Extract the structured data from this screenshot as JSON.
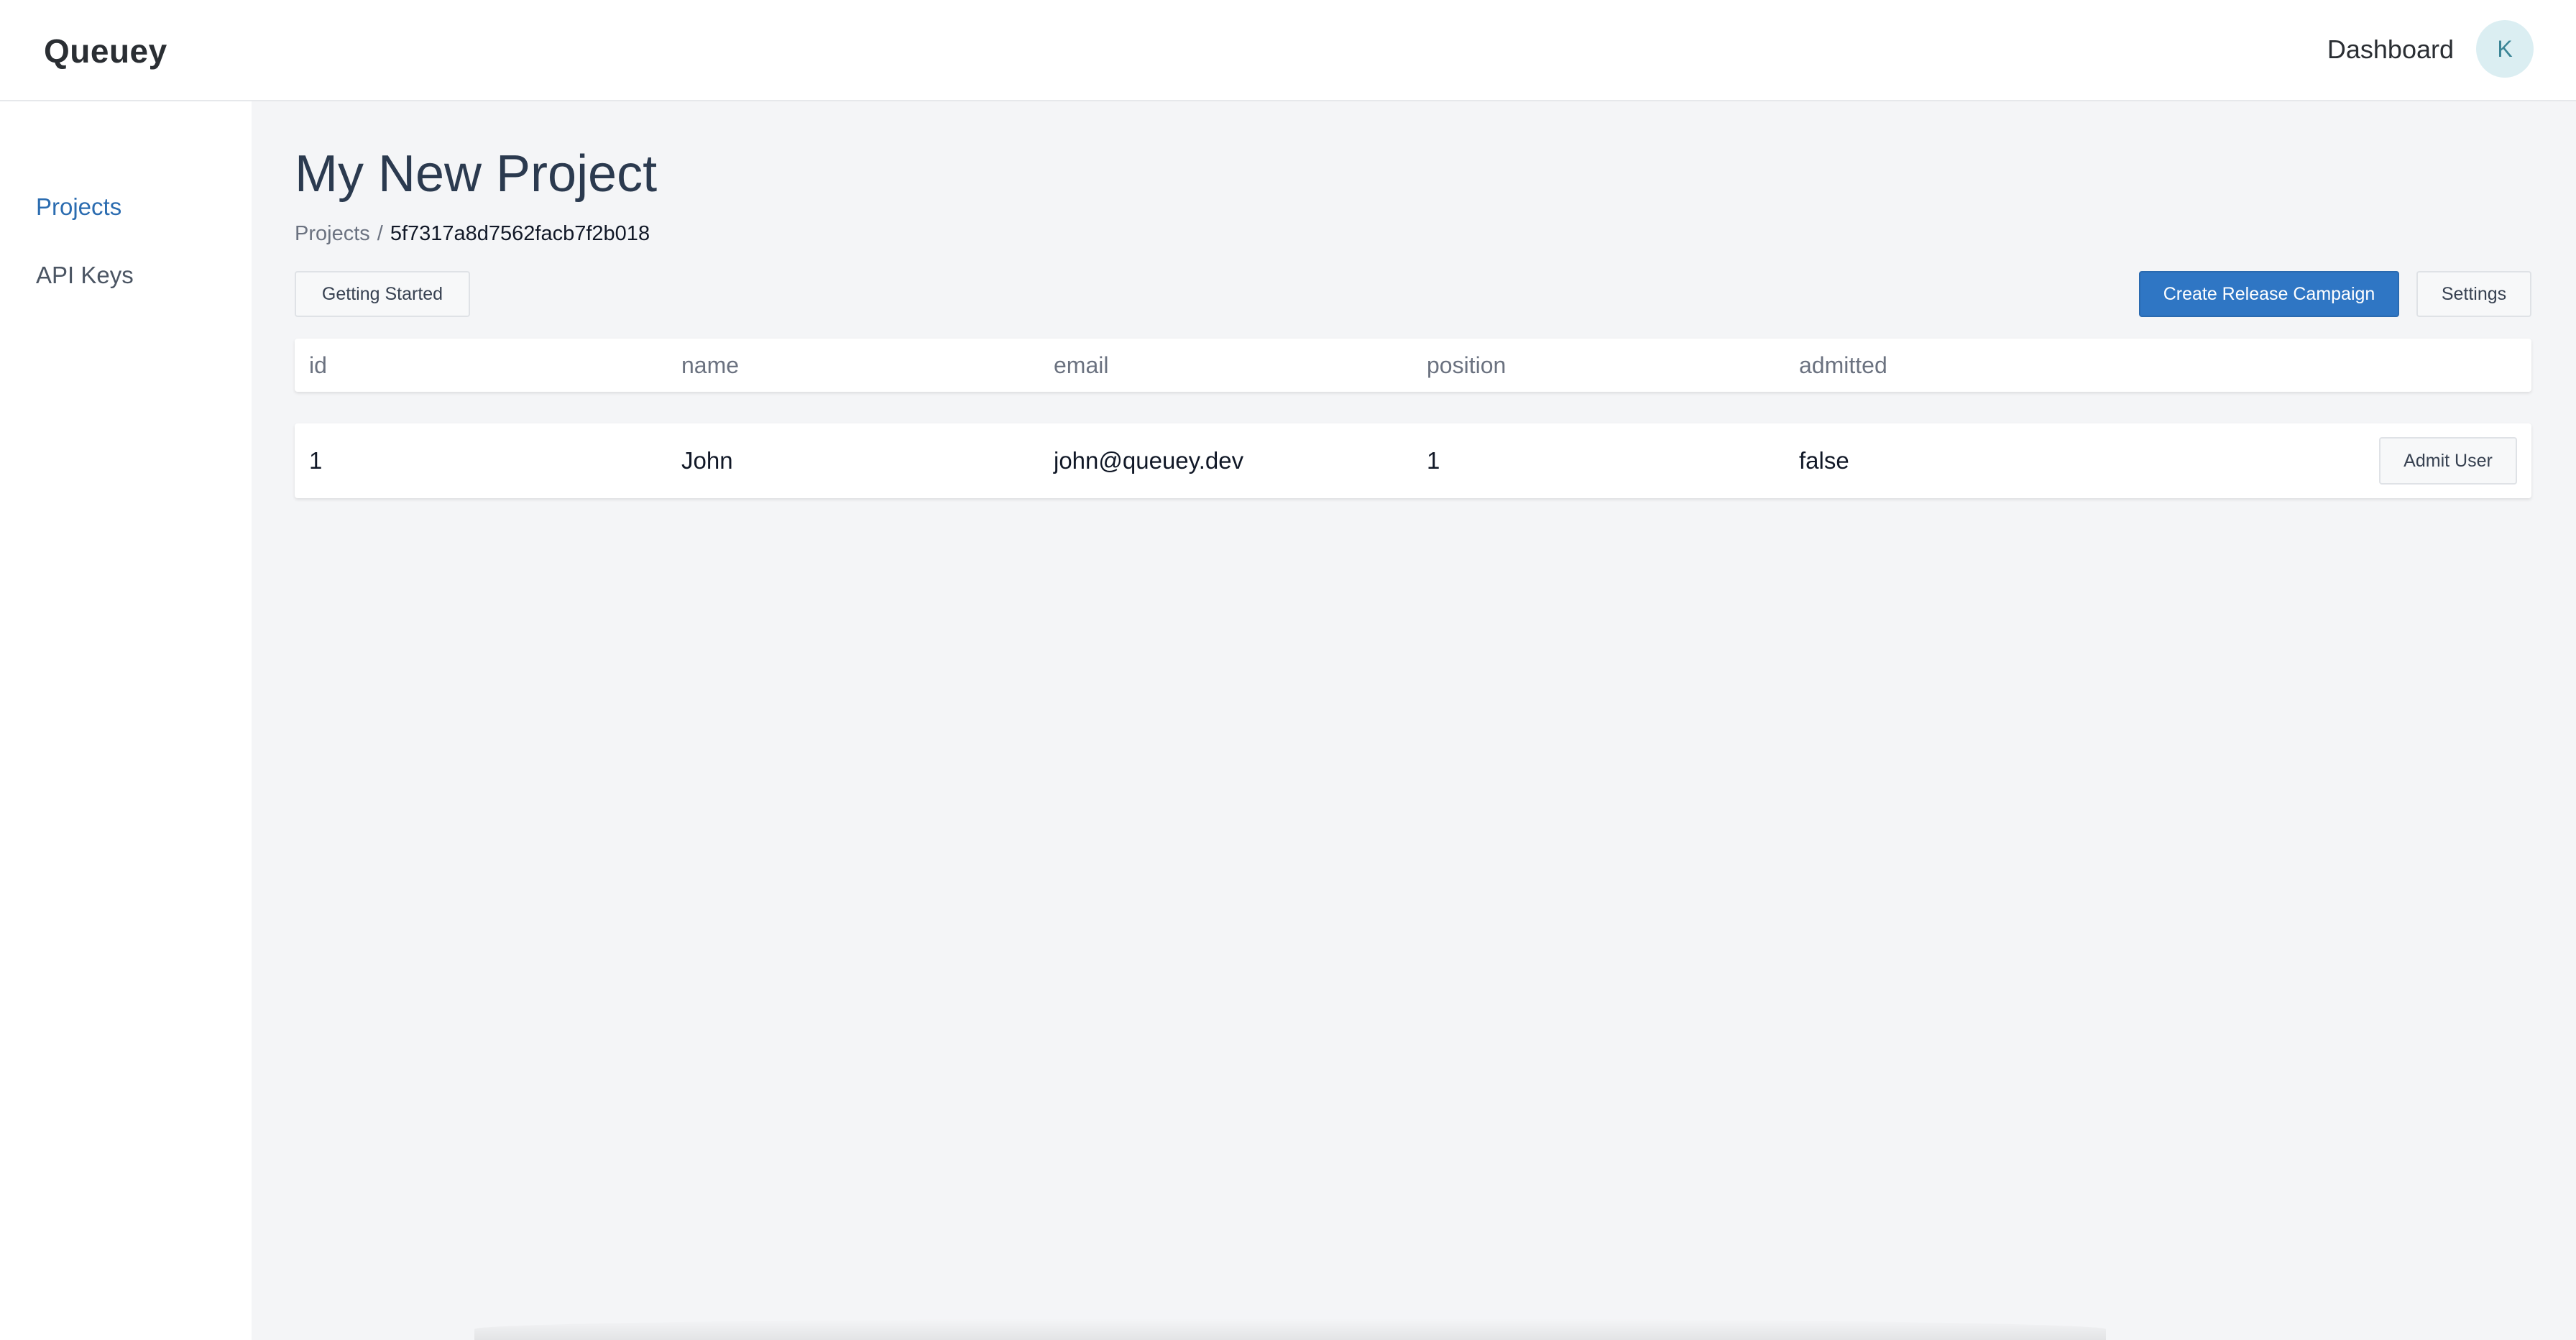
{
  "header": {
    "brand": "Queuey",
    "nav_dashboard": "Dashboard",
    "avatar_initial": "K"
  },
  "sidebar": {
    "items": [
      {
        "label": "Projects",
        "active": true
      },
      {
        "label": "API Keys",
        "active": false
      }
    ]
  },
  "main": {
    "title": "My New Project",
    "breadcrumb": {
      "parent": "Projects",
      "separator": "/",
      "current": "5f7317a8d7562facb7f2b018"
    },
    "buttons": {
      "getting_started": "Getting Started",
      "create_release_campaign": "Create Release Campaign",
      "settings": "Settings"
    },
    "table": {
      "columns": [
        "id",
        "name",
        "email",
        "position",
        "admitted"
      ],
      "rows": [
        {
          "cells": [
            "1",
            "John",
            "john@queuey.dev",
            "1",
            "false"
          ],
          "action": "Admit User"
        }
      ]
    }
  },
  "colors": {
    "accent": "#2f76c4",
    "sidebar_active": "#2b6cb0",
    "page_bg": "#f4f5f7",
    "avatar_bg": "#dbeef2"
  }
}
